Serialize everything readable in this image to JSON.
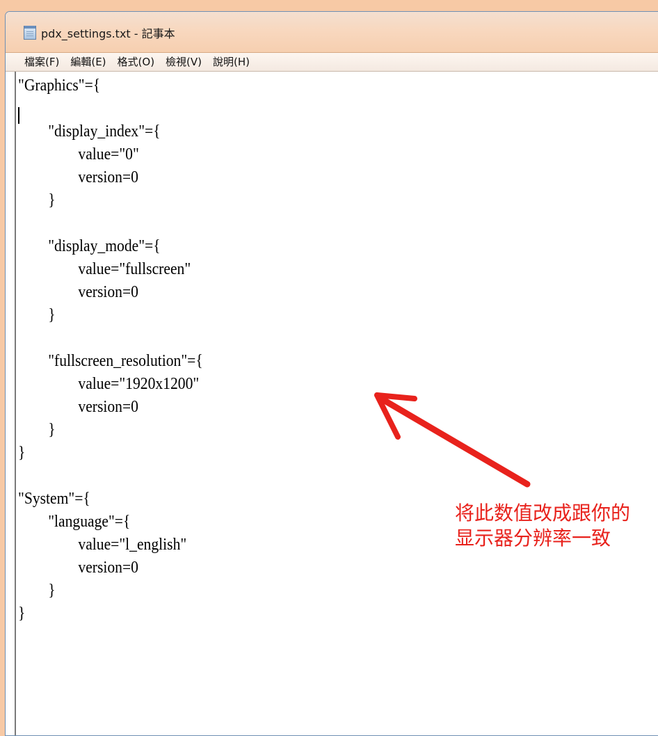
{
  "window": {
    "title": "pdx_settings.txt - 記事本"
  },
  "menu": [
    {
      "label": "檔案(F)"
    },
    {
      "label": "編輯(E)"
    },
    {
      "label": "格式(O)"
    },
    {
      "label": "檢視(V)"
    },
    {
      "label": "說明(H)"
    }
  ],
  "editor": {
    "content": "\"Graphics\"={\n\n\t\"display_index\"={\n\t\tvalue=\"0\"\n\t\tversion=0\n\t}\n\n\t\"display_mode\"={\n\t\tvalue=\"fullscreen\"\n\t\tversion=0\n\t}\n\n\t\"fullscreen_resolution\"={\n\t\tvalue=\"1920x1200\"\n\t\tversion=0\n\t}\n}\n\n\"System\"={\n\t\"language\"={\n\t\tvalue=\"l_english\"\n\t\tversion=0\n\t}\n}"
  },
  "annotation": {
    "text": "将此数值改成跟你的\n显示器分辨率一致",
    "color": "#e8221c"
  },
  "icons": {
    "app": "notepad-icon"
  }
}
